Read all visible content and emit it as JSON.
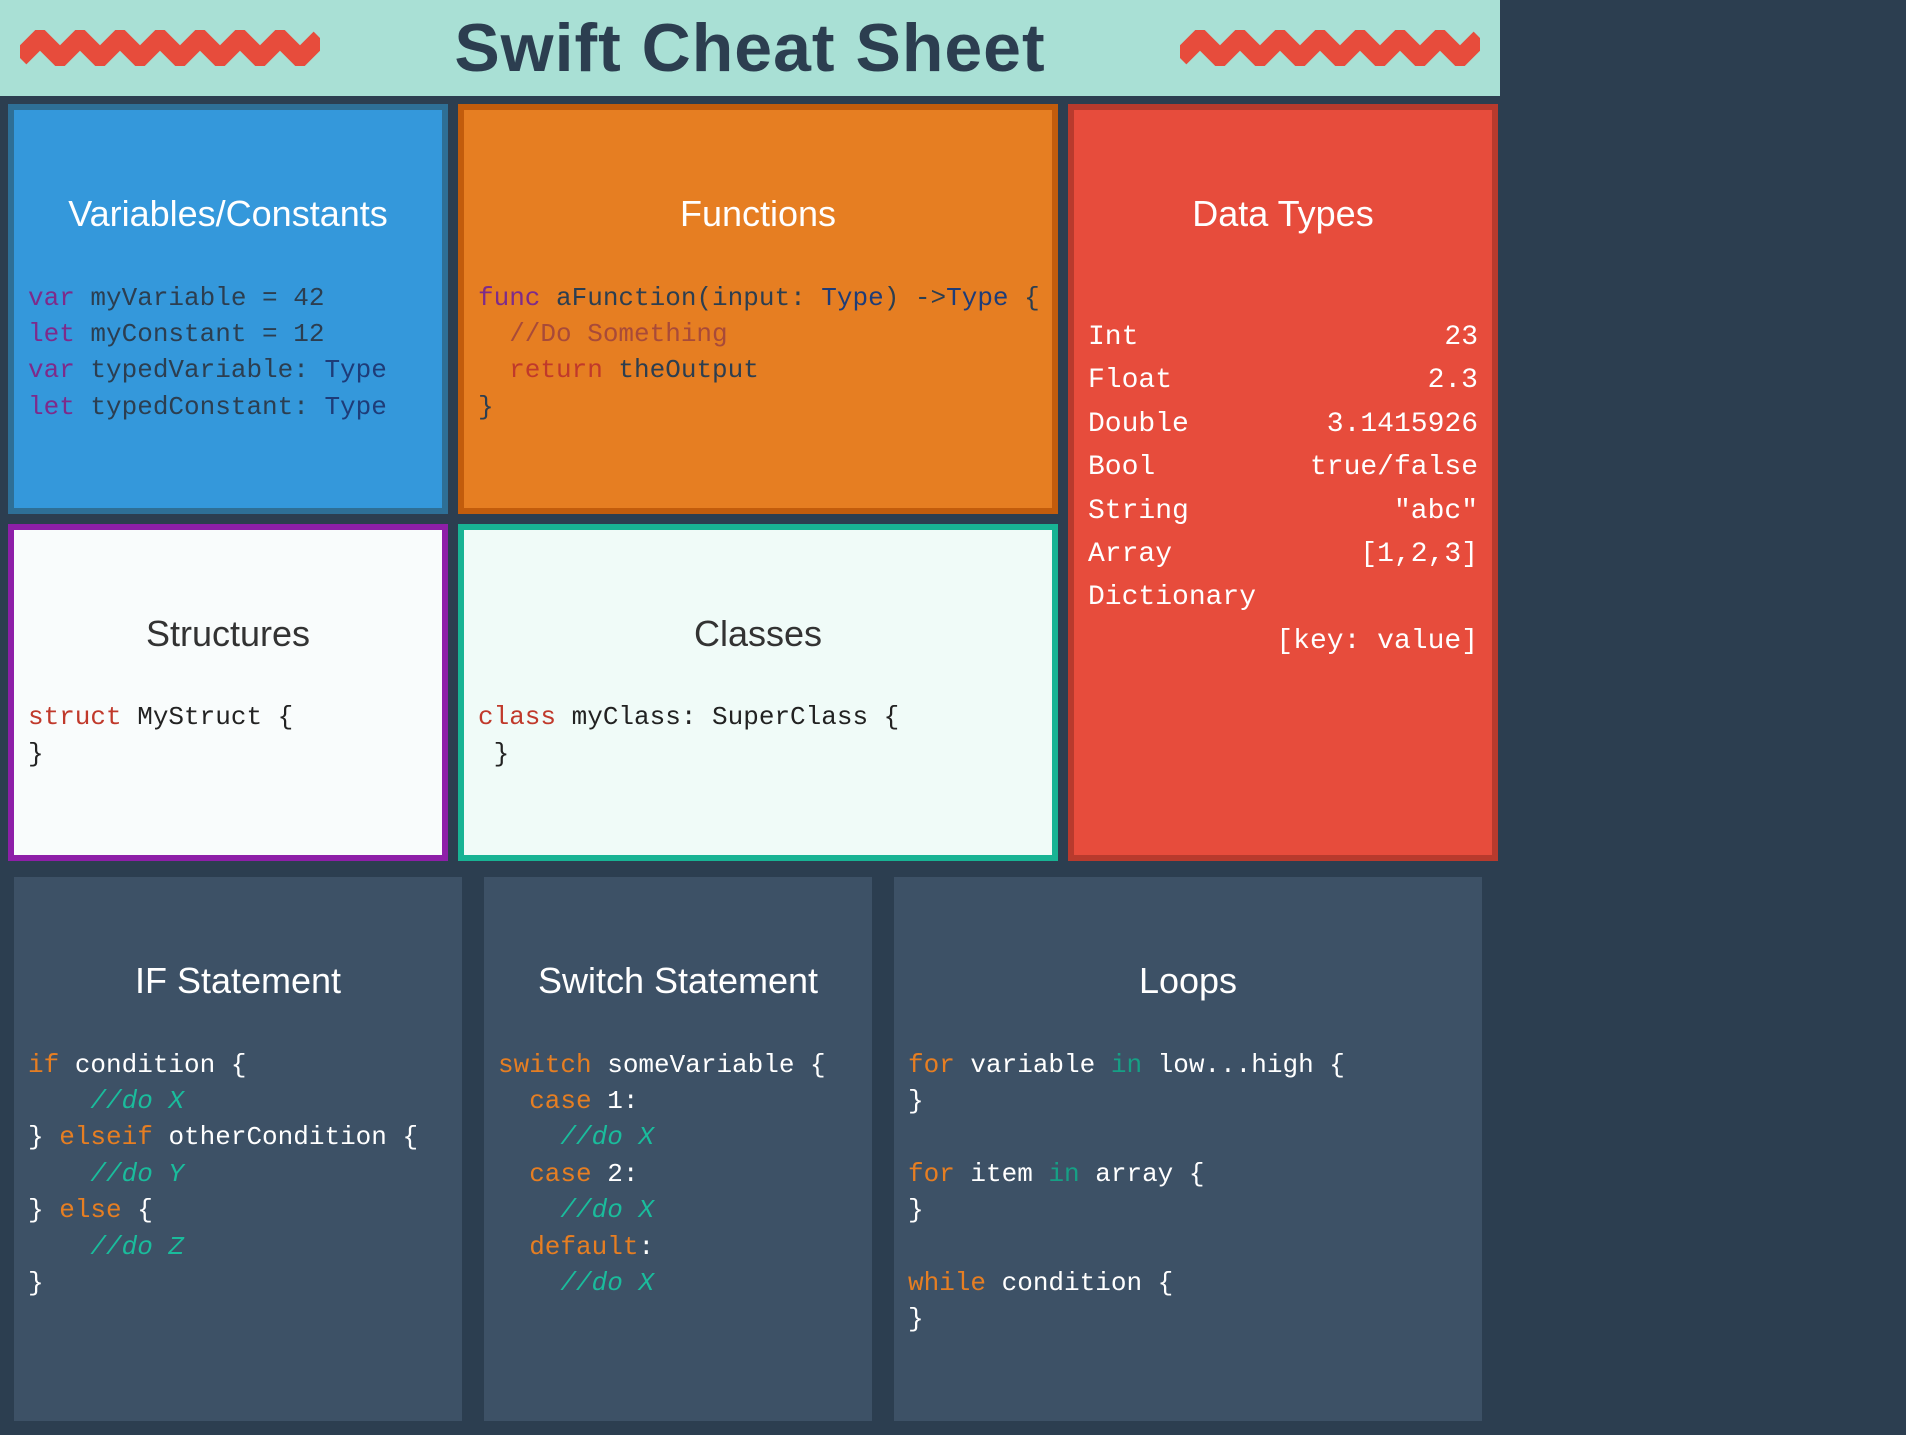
{
  "title": "Swift Cheat Sheet",
  "cards": {
    "variables": {
      "title": "Variables/Constants"
    },
    "functions": {
      "title": "Functions"
    },
    "datatypes": {
      "title": "Data Types"
    },
    "structures": {
      "title": "Structures"
    },
    "classes": {
      "title": "Classes"
    },
    "ifstmt": {
      "title": "IF Statement"
    },
    "switchstmt": {
      "title": "Switch Statement"
    },
    "loops": {
      "title": "Loops"
    }
  },
  "code": {
    "variables": {
      "l1_kw": "var",
      "l1_rest": " myVariable = 42",
      "l2_kw": "let",
      "l2_rest": " myConstant = 12",
      "l3_kw": "var",
      "l3_mid": " typedVariable: ",
      "l3_type": "Type",
      "l4_kw": "let",
      "l4_mid": " typedConstant: ",
      "l4_type": "Type"
    },
    "functions": {
      "l1_kw": "func",
      "l1_mid": " aFunction(input: ",
      "l1_type1": "Type",
      "l1_arrow": ") ->",
      "l1_type2": "Type",
      "l1_end": " {",
      "l2_comment": "  //Do Something",
      "l3_kw": "  return",
      "l3_rest": " theOutput",
      "l4": "}"
    },
    "structures": {
      "l1_kw": "struct",
      "l1_rest": " MyStruct {",
      "l2": "}"
    },
    "classes": {
      "l1_kw": "class",
      "l1_rest": " myClass: SuperClass {",
      "l2": " }"
    },
    "ifstmt": {
      "l1_kw": "if",
      "l1_rest": " condition {",
      "l2": "    //do X",
      "l3a": "} ",
      "l3_kw": "elseif",
      "l3b": " otherCondition {",
      "l4": "    //do Y",
      "l5a": "} ",
      "l5_kw": "else",
      "l5b": " {",
      "l6": "    //do Z",
      "l7": "}"
    },
    "switchstmt": {
      "l1_kw": "switch",
      "l1_rest": " someVariable {",
      "l2_kw": "  case",
      "l2_rest": " 1:",
      "l3": "    //do X",
      "l4_kw": "  case",
      "l4_rest": " 2:",
      "l5": "    //do X",
      "l6_kw": "  default",
      "l6_rest": ":",
      "l7": "    //do X"
    },
    "loops": {
      "l1_kw": "for",
      "l1_mid": " variable ",
      "l1_in": "in",
      "l1_rest": " low...high {",
      "l2": "}",
      "l3": "",
      "l4_kw": "for",
      "l4_mid": " item ",
      "l4_in": "in",
      "l4_rest": " array {",
      "l5": "}",
      "l6": "",
      "l7_kw": "while",
      "l7_rest": " condition {",
      "l8": "}"
    }
  },
  "datatypes": [
    {
      "name": "Int",
      "example": "23"
    },
    {
      "name": "Float",
      "example": "2.3"
    },
    {
      "name": "Double",
      "example": "3.1415926"
    },
    {
      "name": "Bool",
      "example": "true/false"
    },
    {
      "name": "String",
      "example": "\"abc\""
    },
    {
      "name": "Array",
      "example": "[1,2,3]"
    },
    {
      "name": "Dictionary",
      "example": ""
    },
    {
      "name": "",
      "example": "[key: value]"
    }
  ]
}
